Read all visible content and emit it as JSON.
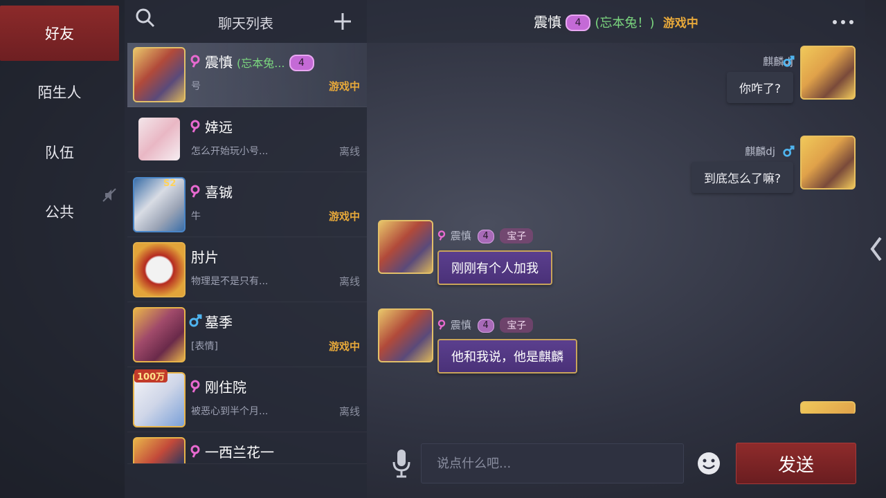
{
  "nav": {
    "items": [
      {
        "label": "好友",
        "active": true
      },
      {
        "label": "陌生人",
        "active": false
      },
      {
        "label": "队伍",
        "active": false
      },
      {
        "label": "公共",
        "active": false
      }
    ]
  },
  "list": {
    "title": "聊天列表",
    "rows": [
      {
        "name": "震慎",
        "remark": "(忘本兔...",
        "badge": "4",
        "preview": "号",
        "status": "游戏中",
        "gender": "female"
      },
      {
        "name": "婞远",
        "preview": "怎么开始玩小号...",
        "status": "离线",
        "gender": "female"
      },
      {
        "name": "喜铖",
        "preview": "牛",
        "status": "游戏中",
        "gender": "female",
        "avatar_badge": "S2"
      },
      {
        "name": "肘片",
        "preview": "物理是不是只有...",
        "status": "离线",
        "gender": "none"
      },
      {
        "name": "墓季",
        "preview": "[表情]",
        "status": "游戏中",
        "gender": "male"
      },
      {
        "name": "刚住院",
        "preview": "被恶心到半个月...",
        "status": "离线",
        "gender": "female",
        "avatar_badge": "100万"
      },
      {
        "name": "一西兰花一",
        "preview": "",
        "status": "",
        "gender": "female"
      }
    ]
  },
  "conversation": {
    "name": "震慎",
    "badge": "4",
    "remark": "(忘本兔！)",
    "status": "游戏中",
    "messages": [
      {
        "side": "right",
        "sender": "麒麟dj",
        "text": "你咋了?"
      },
      {
        "side": "right",
        "sender": "麒麟dj",
        "text": "到底怎么了嘛?"
      },
      {
        "side": "left",
        "sender": "震慎",
        "badge": "4",
        "title": "宝子",
        "text": "刚刚有个人加我"
      },
      {
        "side": "left",
        "sender": "震慎",
        "badge": "4",
        "title": "宝子",
        "text": "他和我说，他是麒麟"
      }
    ]
  },
  "input": {
    "placeholder": "说点什么吧...",
    "send_label": "发送"
  },
  "colors": {
    "accent_red": "#8e2b2b",
    "online": "#e8a93a",
    "remark_green": "#7bd67f",
    "female": "#e86ad0",
    "male": "#4fb4ef"
  }
}
